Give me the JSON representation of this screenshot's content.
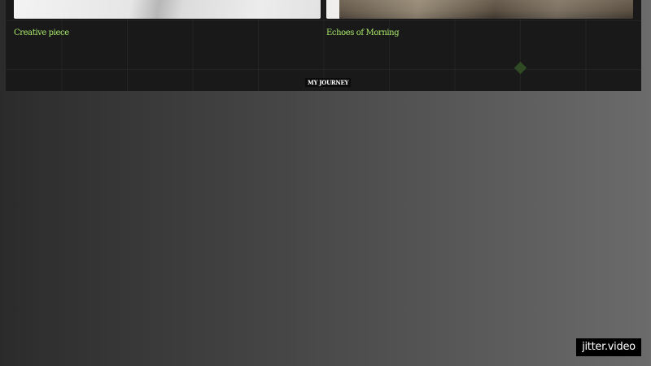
{
  "panel": {
    "cards": [
      {
        "caption": "Creative piece"
      },
      {
        "caption": "Echoes of Morning"
      }
    ],
    "journey_label": "MY JOURNEY"
  },
  "watermark": {
    "text": "jitter.video"
  },
  "colors": {
    "caption": "#a8e86a",
    "panel_bg": "#191919",
    "accent_diamond": "#2f4a25"
  },
  "icons": {
    "decorative_marker": "diamond-icon"
  }
}
